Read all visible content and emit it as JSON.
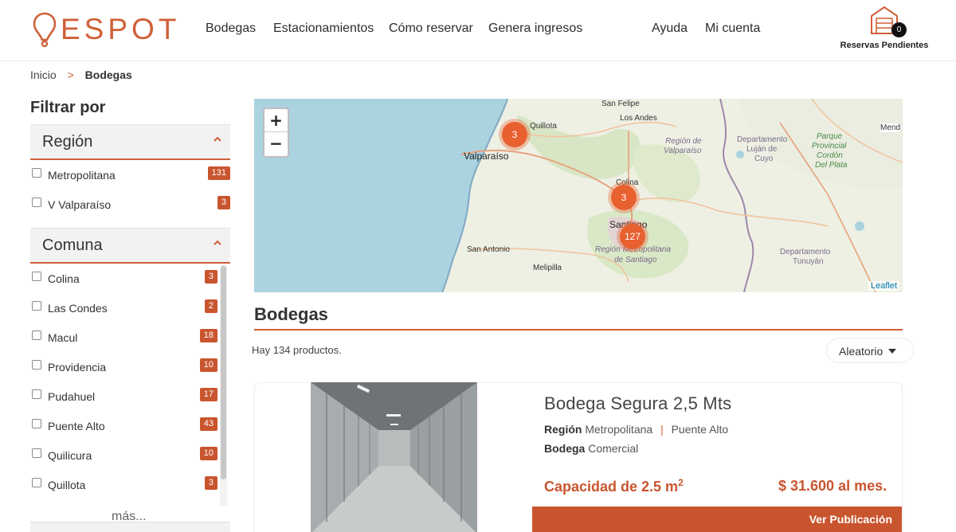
{
  "brand": {
    "logo_text": "ESPOT",
    "accent_color": "#d0603a"
  },
  "nav": {
    "bodegas": "Bodegas",
    "estacionamientos": "Estacionamientos",
    "como_reservar": "Cómo reservar",
    "genera_ingresos": "Genera ingresos",
    "ayuda": "Ayuda",
    "mi_cuenta": "Mi cuenta"
  },
  "reservas": {
    "count": "0",
    "label": "Reservas Pendientes",
    "icon": "garage-icon"
  },
  "breadcrumb": {
    "home": "Inicio",
    "separator": ">",
    "current": "Bodegas"
  },
  "sidebar": {
    "heading": "Filtrar por",
    "region": {
      "title": "Región",
      "items": [
        {
          "label": "Metropolitana",
          "count": "131"
        },
        {
          "label": "V Valparaíso",
          "count": "3"
        }
      ]
    },
    "comuna": {
      "title": "Comuna",
      "items": [
        {
          "label": "Colina",
          "count": "3"
        },
        {
          "label": "Las Condes",
          "count": "2"
        },
        {
          "label": "Macul",
          "count": "18"
        },
        {
          "label": "Providencia",
          "count": "10"
        },
        {
          "label": "Pudahuel",
          "count": "17"
        },
        {
          "label": "Puente Alto",
          "count": "43"
        },
        {
          "label": "Quilicura",
          "count": "10"
        },
        {
          "label": "Quillota",
          "count": "3"
        }
      ]
    },
    "more": "más..."
  },
  "map": {
    "zoom_in": "+",
    "zoom_out": "−",
    "attribution": "Leaflet",
    "places": {
      "san_felipe": "San Felipe",
      "los_andes": "Los Andes",
      "quillota": "Quillota",
      "valparaiso": "Valparaíso",
      "region_valparaiso_1": "Región de",
      "region_valparaiso_2": "Valparaíso",
      "depto_lujan_1": "Departamento",
      "depto_lujan_2": "Luján de",
      "depto_lujan_3": "Cuyo",
      "parque_1": "Parque",
      "parque_2": "Provincial",
      "parque_3": "Cordón",
      "parque_4": "Del Plata",
      "mendoza": "Mend",
      "colina": "Colina",
      "santiago": "Santiago",
      "san_antonio": "San Antonio",
      "melipilla": "Melipilla",
      "region_metro_1": "Región Metropolitana",
      "region_metro_2": "de Santiago",
      "depto_tunuyan_1": "Departamento",
      "depto_tunuyan_2": "Tunuyán"
    },
    "clusters": [
      {
        "count": "3",
        "place": "Quillota"
      },
      {
        "count": "3",
        "place": "Colina"
      },
      {
        "count": "127",
        "place": "Santiago"
      }
    ]
  },
  "products": {
    "title": "Bodegas",
    "count_text": "Hay 134 productos.",
    "sort_label": "Aleatorio",
    "items": [
      {
        "title": "Bodega Segura 2,5 Mts",
        "region_label": "Región",
        "region": "Metropolitana",
        "comuna": "Puente Alto",
        "type_label": "Bodega",
        "type": "Comercial",
        "capacity_text": "Capacidad de 2.5 m",
        "capacity_sup": "2",
        "price": "$ 31.600 al mes.",
        "button": "Ver Publicación"
      }
    ]
  }
}
